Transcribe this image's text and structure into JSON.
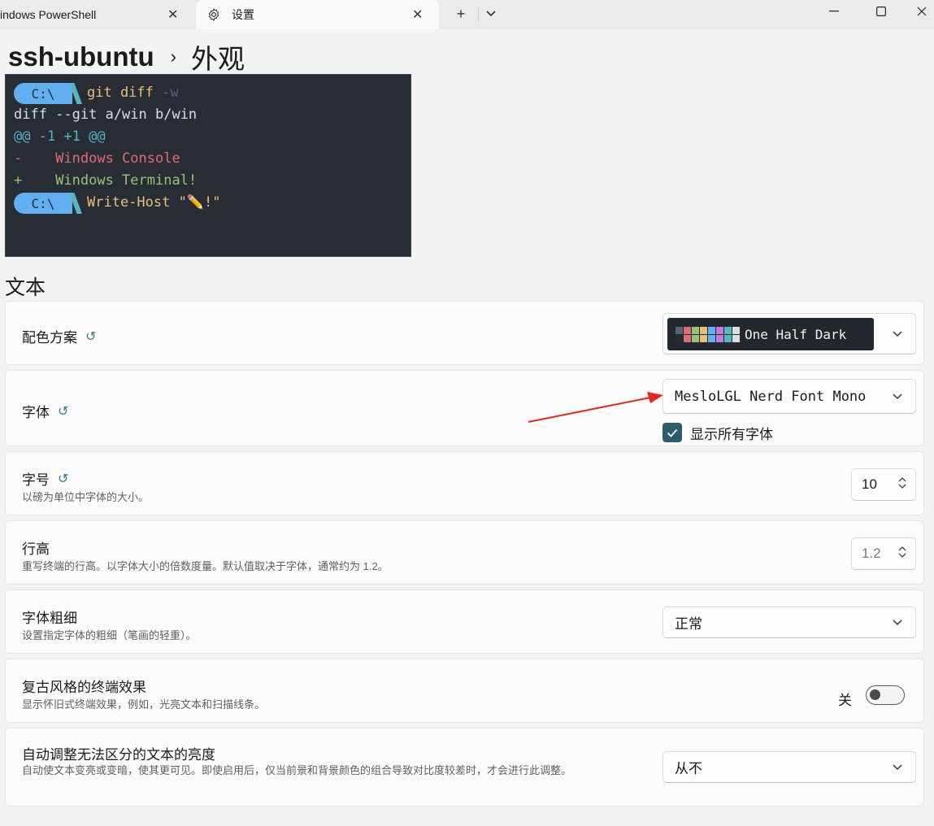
{
  "tabs": [
    {
      "label": "indows PowerShell"
    },
    {
      "label": "设置"
    }
  ],
  "breadcrumb": {
    "parent": "ssh-ubuntu",
    "current": "外观"
  },
  "preview": {
    "prompt1": "C:\\",
    "cmd1_a": "git diff ",
    "cmd1_b": "-w",
    "line2": "diff --git a/win b/win",
    "line3": "@@ -1 +1 @@",
    "line4": "-    Windows Console",
    "line5": "+    Windows Terminal!",
    "prompt2": "C:\\",
    "cmd2": "Write-Host \"✏️!\""
  },
  "section_title": "文本",
  "settings": {
    "color_scheme": {
      "title": "配色方案",
      "value": "One Half Dark",
      "swatches": [
        "#282c34",
        "#e06c75",
        "#98c379",
        "#e5c07b",
        "#61afef",
        "#c678dd",
        "#56b6c2",
        "#dcdfe4",
        "#5a6374",
        "#e06c75",
        "#98c379",
        "#e5c07b",
        "#61afef",
        "#c678dd",
        "#56b6c2",
        "#dcdfe4"
      ]
    },
    "font": {
      "title": "字体",
      "value": "MesloLGL Nerd Font Mono",
      "checkbox_label": "显示所有字体",
      "checked": true
    },
    "font_size": {
      "title": "字号",
      "desc": "以磅为单位中字体的大小。",
      "value": "10"
    },
    "line_height": {
      "title": "行高",
      "desc": "重写终端的行高。以字体大小的倍数度量。默认值取决于字体，通常约为 1.2。",
      "placeholder": "1.2"
    },
    "font_weight": {
      "title": "字体粗细",
      "desc": "设置指定字体的粗细（笔画的轻重）。",
      "value": "正常"
    },
    "retro": {
      "title": "复古风格的终端效果",
      "desc": "显示怀旧式终端效果，例如，光亮文本和扫描线条。",
      "toggle_label": "关",
      "on": false
    },
    "contrast": {
      "title": "自动调整无法区分的文本的亮度",
      "desc": "自动使文本变亮或变暗，使其更可见。即使启用后，仅当前景和背景颜色的组合导致对比度较差时，才会进行此调整。",
      "value": "从不"
    }
  },
  "colors": {
    "accent": "#2b5d6d",
    "annotation_arrow": "#e8231a",
    "preview_bg": "#282c34"
  }
}
